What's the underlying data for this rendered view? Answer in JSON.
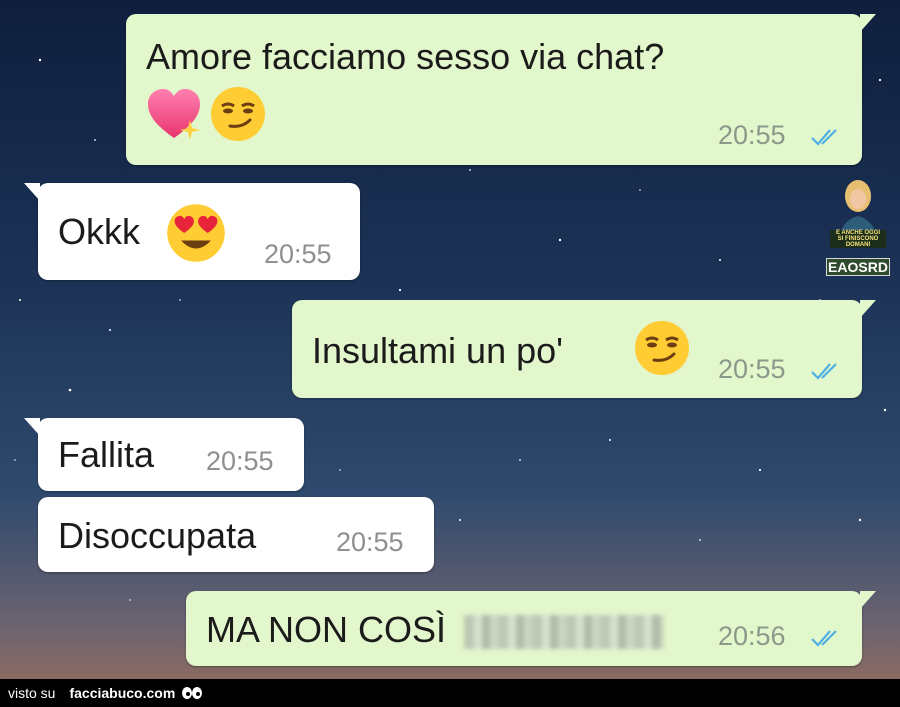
{
  "messages": [
    {
      "direction": "outgoing",
      "text": "Amore facciamo sesso via chat?",
      "emojis": [
        "sparkling-heart",
        "smirking-face"
      ],
      "time": "20:55",
      "read": true
    },
    {
      "direction": "incoming",
      "text": "Okkk",
      "emojis": [
        "heart-eyes-face"
      ],
      "time": "20:55"
    },
    {
      "direction": "outgoing",
      "text": "Insultami un po'",
      "emojis": [
        "smirking-face"
      ],
      "time": "20:55",
      "read": true
    },
    {
      "direction": "incoming",
      "text": "Fallita",
      "time": "20:55"
    },
    {
      "direction": "incoming",
      "text": "Disoccupata",
      "time": "20:55"
    },
    {
      "direction": "outgoing",
      "text": "MA NON COSÌ",
      "redacted": true,
      "time": "20:56",
      "read": true
    }
  ],
  "watermark": {
    "lines": [
      "E ANCHE OGGI",
      "SI FINISCONO DOMANI"
    ],
    "brand": "EAOSRD"
  },
  "footer": {
    "prefix": "visto su",
    "site": "facciabuco.com"
  },
  "colors": {
    "outgoing_bubble": "#e2f7cb",
    "incoming_bubble": "#ffffff",
    "read_ticks": "#4fb0e6"
  }
}
